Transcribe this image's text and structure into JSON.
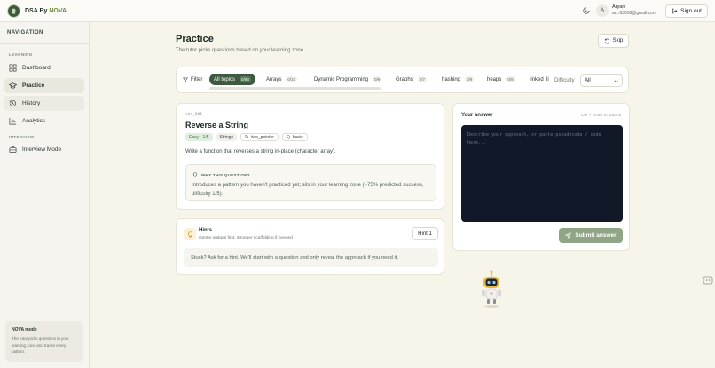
{
  "brand": {
    "name": "DSA By ",
    "accent": "NOVA",
    "accent_color": "#6b8f3a",
    "primary_color": "#3d5a40"
  },
  "header": {
    "user_initial": "A",
    "user_name": "Aryan",
    "user_email": "ar...63058@gmail.com",
    "signout_label": "Sign out"
  },
  "sidebar": {
    "title": "NAVIGATION",
    "section_learning": "LEARNING",
    "section_interview": "INTERVIEW",
    "items": [
      {
        "label": "Dashboard",
        "icon": "grid-icon"
      },
      {
        "label": "Practice",
        "icon": "graduation-cap-icon"
      },
      {
        "label": "History",
        "icon": "history-icon"
      },
      {
        "label": "Analytics",
        "icon": "bar-chart-icon"
      },
      {
        "label": "Interview Mode",
        "icon": "briefcase-icon"
      }
    ],
    "mode_card": {
      "title": "NOVA mode",
      "desc": "The tutor picks questions in your learning zone and tracks every pattern."
    }
  },
  "page": {
    "title": "Practice",
    "subtitle": "The tutor picks questions based on your learning zone.",
    "skip_label": "Skip"
  },
  "filters": {
    "label": "Filter",
    "chips": [
      {
        "label": "All topics",
        "count": "0/88",
        "active": true
      },
      {
        "label": "Arrays",
        "count": "0/10"
      },
      {
        "label": "Dynamic Programming",
        "count": "0/9"
      },
      {
        "label": "Graphs",
        "count": "0/7"
      },
      {
        "label": "hashing",
        "count": "0/9"
      },
      {
        "label": "heaps",
        "count": "0/8"
      },
      {
        "label": "linked_li",
        "count": ""
      }
    ],
    "difficulty_label": "Difficulty",
    "difficulty_value": "All"
  },
  "question": {
    "id": "str_001",
    "title": "Reverse a String",
    "tags": [
      {
        "label": "Easy · 1/5",
        "kind": "easy"
      },
      {
        "label": "Strings",
        "kind": "plain"
      },
      {
        "label": "two_pointer",
        "kind": "outline"
      },
      {
        "label": "basic",
        "kind": "outline"
      }
    ],
    "description": "Write a function that reverses a string in-place (character array).",
    "why_heading": "WHY THIS QUESTION?",
    "why_text": "Introduces a pattern you haven't practiced yet; sits in your learning zone (~75% predicted success, difficulty 1/5)."
  },
  "hints": {
    "title": "Hints",
    "subtitle": "Gentle nudges first, stronger scaffolding if needed",
    "button_label": "Hint 1",
    "placeholder": "Stuck? Ask for a hint. We'll start with a question and only reveal the approach if you need it."
  },
  "answer": {
    "label": "Your answer",
    "shortcut": "Ctrl + Enter to submit",
    "placeholder": "Describe your approach, or paste pseudocode / code here...",
    "value": "",
    "submit_label": "Submit answer"
  }
}
